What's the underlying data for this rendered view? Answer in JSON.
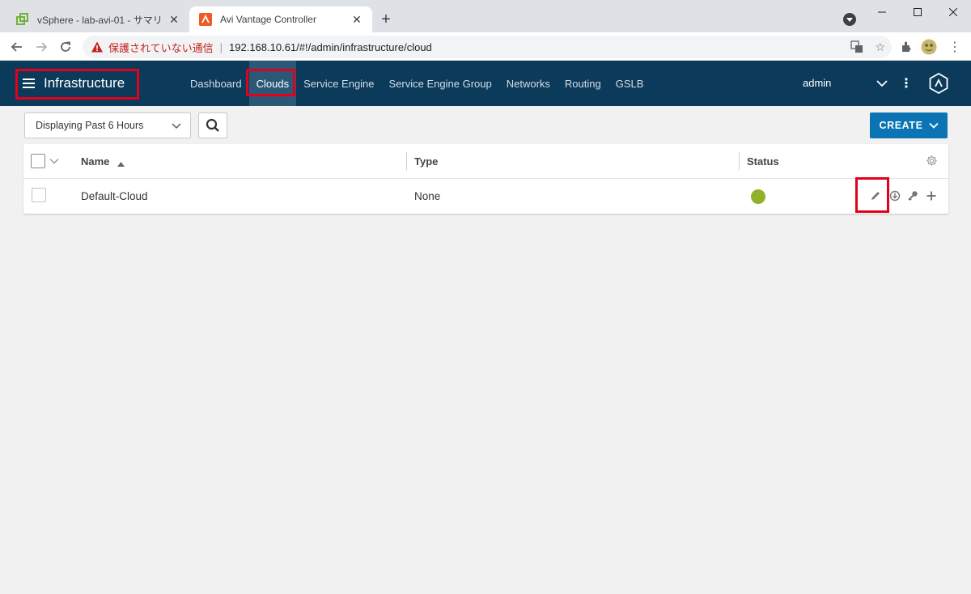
{
  "browser": {
    "tabs": [
      {
        "title": "vSphere - lab-avi-01 - サマリ",
        "favicon": "vsphere-icon",
        "active": false
      },
      {
        "title": "Avi Vantage Controller",
        "favicon": "avi-icon",
        "active": true
      }
    ],
    "new_tab_label": "+",
    "security_warning": "保護されていない通信",
    "url": "192.168.10.61/#!/admin/infrastructure/cloud"
  },
  "app": {
    "title": "Infrastructure",
    "nav": [
      {
        "label": "Dashboard",
        "active": false
      },
      {
        "label": "Clouds",
        "active": true
      },
      {
        "label": "Service Engine",
        "active": false
      },
      {
        "label": "Service Engine Group",
        "active": false
      },
      {
        "label": "Networks",
        "active": false
      },
      {
        "label": "Routing",
        "active": false
      },
      {
        "label": "GSLB",
        "active": false
      }
    ],
    "user": "admin"
  },
  "toolbar": {
    "time_range": "Displaying Past 6 Hours",
    "create_label": "CREATE"
  },
  "grid": {
    "columns": {
      "name": "Name",
      "type": "Type",
      "status": "Status"
    },
    "rows": [
      {
        "name": "Default-Cloud",
        "type": "None",
        "status": "green"
      }
    ]
  },
  "colors": {
    "header_bg": "#0b3a5b",
    "nav_active_bg": "#2c5877",
    "create_button": "#0b74b5",
    "status_ok": "#8fb22a",
    "highlight": "#e2001a"
  }
}
